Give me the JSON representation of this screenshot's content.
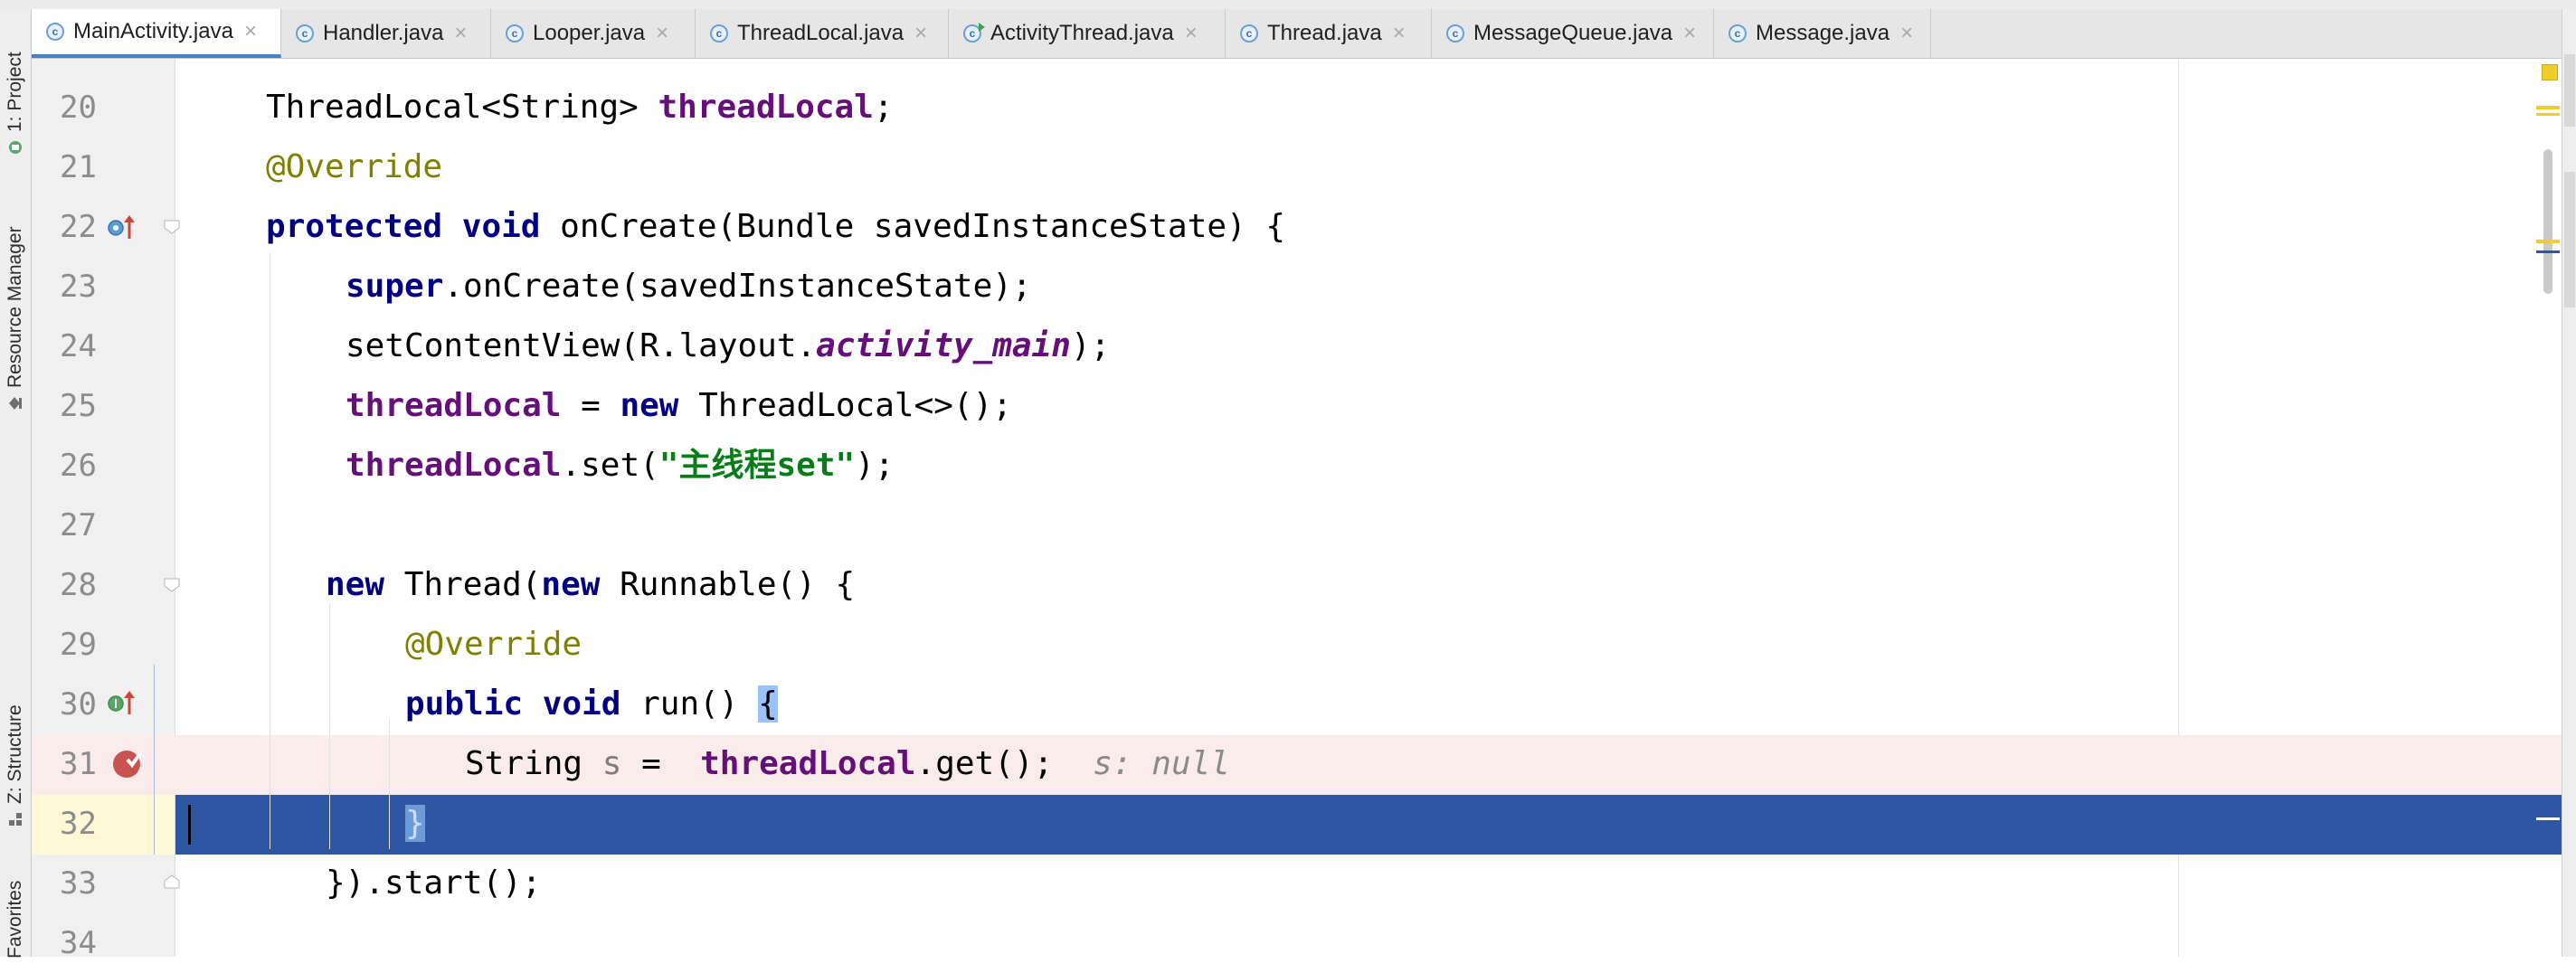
{
  "left_toolbar": {
    "project_tab": "1: Project",
    "resource_manager_tab": "Resource Manager",
    "structure_tab": "Z: Structure",
    "favorites_tab": "Favorites"
  },
  "tabs": [
    {
      "label": "MainActivity.java"
    },
    {
      "label": "Handler.java"
    },
    {
      "label": "Looper.java"
    },
    {
      "label": "ThreadLocal.java"
    },
    {
      "label": "ActivityThread.java"
    },
    {
      "label": "Thread.java"
    },
    {
      "label": "MessageQueue.java"
    },
    {
      "label": "Message.java"
    }
  ],
  "line_numbers": [
    "20",
    "21",
    "22",
    "23",
    "24",
    "25",
    "26",
    "27",
    "28",
    "29",
    "30",
    "31",
    "32",
    "33",
    "34"
  ],
  "code": {
    "l20": {
      "a": "ThreadLocal<String> ",
      "b": "threadLocal",
      "c": ";"
    },
    "l21": {
      "a": "@Override"
    },
    "l22": {
      "a": "protected",
      "b": " ",
      "c": "void",
      "d": " onCreate(Bundle savedInstanceState) {"
    },
    "l23": {
      "a": "super",
      "b": ".onCreate(savedInstanceState);"
    },
    "l24": {
      "a": "setContentView(R.layout.",
      "b": "activity_main",
      "c": ");"
    },
    "l25": {
      "a": "threadLocal",
      "b": " = ",
      "c": "new",
      "d": " ThreadLocal<>();"
    },
    "l26": {
      "a": "threadLocal",
      "b": ".set(",
      "c": "\"主线程set\"",
      "d": ");"
    },
    "l28": {
      "a": "new",
      "b": " Thread(",
      "c": "new",
      "d": " Runnable() {"
    },
    "l29": {
      "a": "@Override"
    },
    "l30": {
      "a": "public",
      "b": " ",
      "c": "void",
      "d": " run() ",
      "e": "{"
    },
    "l31": {
      "a": "String ",
      "b": "s",
      "c": " =  ",
      "d": "threadLocal",
      "e": ".get();",
      "f": "s: null"
    },
    "l32": {
      "a": "}"
    },
    "l33": {
      "a": "}).start();"
    }
  },
  "colors": {
    "keyword": "#000080",
    "annotation": "#808000",
    "field": "#660e7a",
    "string": "#067d17",
    "execution_line": "#2f56a3",
    "breakpoint_line": "#faeceb",
    "active_tab_underline": "#4083c9"
  }
}
